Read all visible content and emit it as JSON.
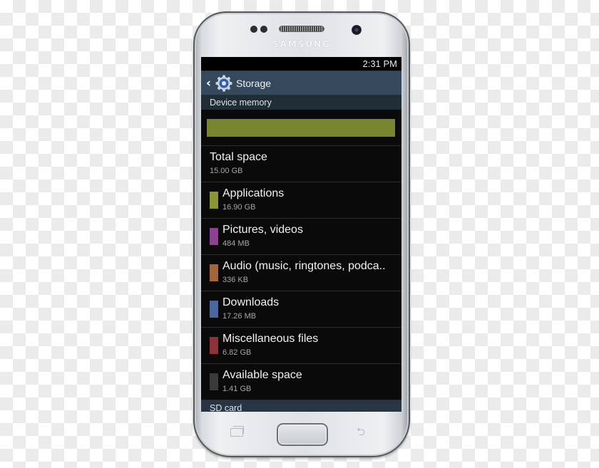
{
  "device": {
    "brand": "SAMSUNG"
  },
  "status_bar": {
    "time": "2:31 PM"
  },
  "action_bar": {
    "back_icon": "chevron-left-icon",
    "app_icon": "gear-settings-icon",
    "title": "Storage"
  },
  "device_memory": {
    "section_label": "Device memory",
    "usage_bar": {
      "segments": [
        {
          "name": "Applications",
          "fraction": 1.0,
          "color": "#7a8530"
        }
      ]
    },
    "total": {
      "label": "Total space",
      "value": "15.00 GB"
    },
    "items": [
      {
        "label": "Applications",
        "value": "16.90 GB",
        "color": "#8a9633"
      },
      {
        "label": "Pictures, videos",
        "value": "484 MB",
        "color": "#8f3f8f"
      },
      {
        "label": "Audio (music, ringtones, podca..",
        "value": "336 KB",
        "color": "#a4643a"
      },
      {
        "label": "Downloads",
        "value": "17.26 MB",
        "color": "#4a68a0"
      },
      {
        "label": "Miscellaneous files",
        "value": "6.82 GB",
        "color": "#8e3238"
      },
      {
        "label": "Available space",
        "value": "1.41 GB",
        "color": "#3a3a3a"
      }
    ]
  },
  "sd_card": {
    "section_label": "SD card"
  },
  "nav_keys": {
    "recent": "recent-apps-icon",
    "home": "home-button",
    "back": "back-icon"
  }
}
